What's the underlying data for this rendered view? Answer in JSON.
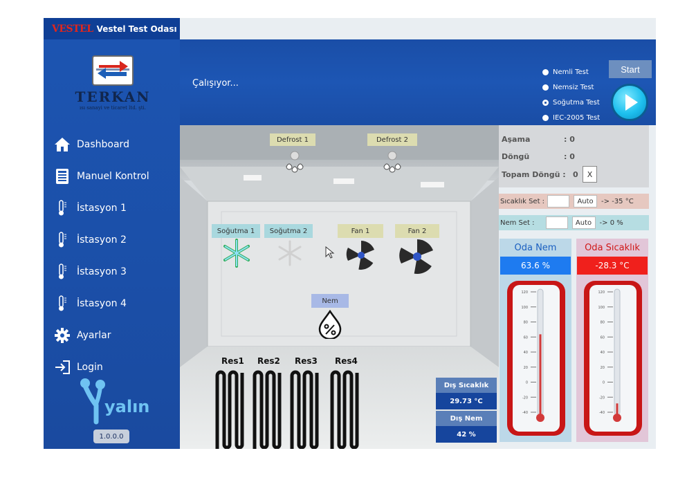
{
  "app": {
    "brand": "VESTEL",
    "title": "Vestel Test Odası"
  },
  "logo": {
    "name": "TERKAN",
    "subtitle": "ısı sanayi ve ticaret ltd. şti."
  },
  "nav": [
    {
      "label": "Dashboard",
      "icon": "home-icon"
    },
    {
      "label": "Manuel Kontrol",
      "icon": "control-panel-icon"
    },
    {
      "label": "İstasyon 1",
      "icon": "thermometer-icon"
    },
    {
      "label": "İstasyon 2",
      "icon": "thermometer-icon"
    },
    {
      "label": "İstasyon 3",
      "icon": "thermometer-icon"
    },
    {
      "label": "İstasyon 4",
      "icon": "thermometer-icon"
    },
    {
      "label": "Ayarlar",
      "icon": "gear-icon"
    },
    {
      "label": "Login",
      "icon": "login-icon"
    }
  ],
  "footer": {
    "logo_text": "yalın",
    "version": "1.0.0.0"
  },
  "header": {
    "status": "Çalışıyor...",
    "start_label": "Start",
    "tests": [
      {
        "label": "Nemli Test",
        "selected": false
      },
      {
        "label": "Nemsiz Test",
        "selected": false
      },
      {
        "label": "Soğutma Test",
        "selected": true
      },
      {
        "label": "IEC-2005 Test",
        "selected": false
      }
    ]
  },
  "room": {
    "defrost1": "Defrost 1",
    "defrost2": "Defrost 2",
    "sogutma1": "Soğutma 1",
    "sogutma2": "Soğutma 2",
    "fan1": "Fan 1",
    "fan2": "Fan 2",
    "nem": "Nem",
    "res": [
      "Res1",
      "Res2",
      "Res3",
      "Res4"
    ],
    "dis_sicaklik_label": "Dış Sıcaklık",
    "dis_sicaklik_value": "29.73 °C",
    "dis_nem_label": "Dış Nem",
    "dis_nem_value": "42 %"
  },
  "info": {
    "asama_label": "Aşama",
    "asama_value": ": 0",
    "dongu_label": "Döngü",
    "dongu_value": ": 0",
    "topam_label": "Topam Döngü :",
    "topam_value": "0",
    "reset_label": "X"
  },
  "sets": {
    "sicaklik_label": "Sıcaklık Set :",
    "sicaklik_auto": "Auto",
    "sicaklik_target": "->  -35 °C",
    "nem_label": "Nem Set :",
    "nem_auto": "Auto",
    "nem_target": "->  0 %"
  },
  "gauges": {
    "nem_title": "Oda Nem",
    "nem_value": "63.6 %",
    "nem_level": 63.6,
    "sicaklik_title": "Oda Sıcaklık",
    "sicaklik_value": "-28.3 °C",
    "sicaklik_level": -28.3,
    "scale": [
      "120",
      "100",
      "80",
      "60",
      "40",
      "20",
      "0",
      "-20",
      "-40"
    ]
  },
  "colors": {
    "sidebar": "#1c55b2",
    "nem_value_bg": "#1e7bf0",
    "sicaklik_value_bg": "#f0201c",
    "thermo_red": "#c81616"
  }
}
